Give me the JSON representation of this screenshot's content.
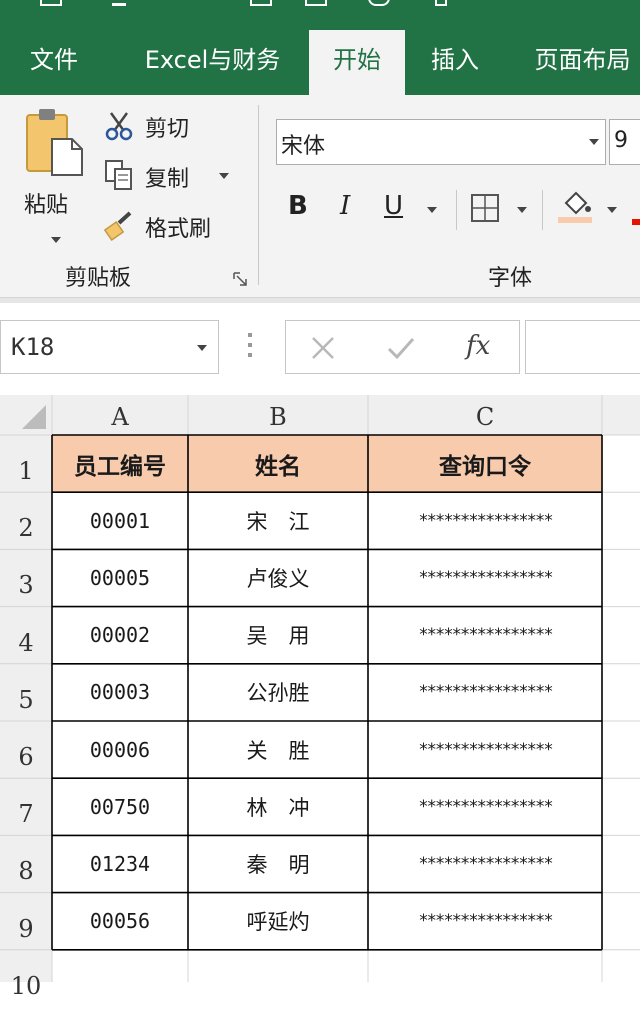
{
  "tabs": [
    {
      "label": "文件",
      "active": false
    },
    {
      "label": "Excel与财务",
      "active": false
    },
    {
      "label": "开始",
      "active": true
    },
    {
      "label": "插入",
      "active": false
    },
    {
      "label": "页面布局",
      "active": false
    }
  ],
  "ribbon": {
    "clipboard": {
      "paste_label": "粘贴",
      "cut_label": "剪切",
      "copy_label": "复制",
      "format_painter_label": "格式刷",
      "group_title": "剪贴板"
    },
    "font": {
      "font_name": "宋体",
      "font_size": "9",
      "group_title": "字体",
      "bold_label": "B",
      "italic_label": "I",
      "underline_label": "U"
    }
  },
  "formula_bar": {
    "name_box": "K18",
    "fx_label": "fx",
    "formula_value": ""
  },
  "sheet": {
    "columns": [
      "A",
      "B",
      "C"
    ],
    "row_numbers": [
      "1",
      "2",
      "3",
      "4",
      "5",
      "6",
      "7",
      "8",
      "9",
      "10"
    ],
    "header": [
      "员工编号",
      "姓名",
      "查询口令"
    ],
    "rows": [
      [
        "00001",
        "宋　江",
        "****************"
      ],
      [
        "00005",
        "卢俊义",
        "****************"
      ],
      [
        "00002",
        "吴　用",
        "****************"
      ],
      [
        "00003",
        "公孙胜",
        "****************"
      ],
      [
        "00006",
        "关　胜",
        "****************"
      ],
      [
        "00750",
        "林　冲",
        "****************"
      ],
      [
        "01234",
        "秦　明",
        "****************"
      ],
      [
        "00056",
        "呼延灼",
        "****************"
      ]
    ],
    "header_fill": "#f8cbad"
  },
  "colors": {
    "accent": "#217346",
    "ribbon_bg": "#f3f3f3",
    "grid_line": "#d4d4d4",
    "cell_border": "#000000"
  },
  "icons": {
    "paste": "clipboard-icon",
    "cut": "scissors-icon",
    "copy": "copy-icon",
    "format_painter": "paintbrush-icon",
    "borders": "borders-icon",
    "fill": "paint-bucket-icon",
    "cancel": "close-icon",
    "enter": "check-icon"
  }
}
